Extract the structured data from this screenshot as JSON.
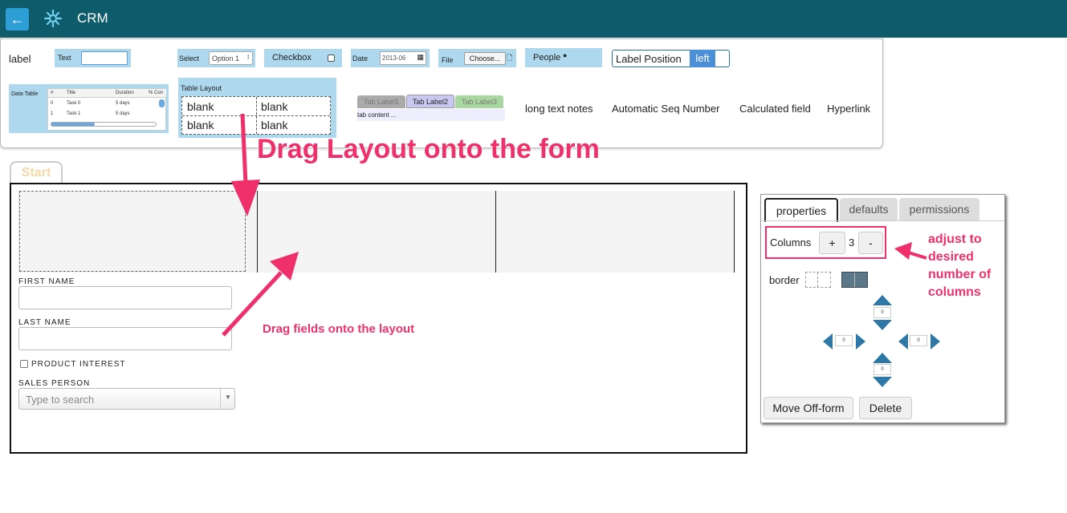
{
  "topbar": {
    "title": "CRM",
    "back_icon": "arrow-left-icon",
    "logo_icon": "asterisk-logo-icon"
  },
  "palette": {
    "label": "label",
    "text": "Text",
    "select": "Select",
    "select_value": "Option 1",
    "checkbox": "Checkbox",
    "date": "Date",
    "date_value": "2013-06",
    "file": "File",
    "file_button": "Choose...",
    "people": "People",
    "label_position": "Label Position",
    "label_position_value": "left",
    "data_table": {
      "label": "Data Table",
      "headers": [
        "#",
        "Title",
        "Duration",
        "% Con"
      ],
      "rows": [
        [
          "0",
          "Task 0",
          "5 days"
        ],
        [
          "1",
          "Task 1",
          "5 days"
        ]
      ]
    },
    "table_layout": {
      "label": "Table Layout",
      "cells": [
        "blank",
        "blank",
        "blank",
        "blank"
      ]
    },
    "tabs": {
      "labels": [
        "Tab Label1",
        "Tab Label2",
        "Tab Label3"
      ],
      "content": "tab content ..."
    },
    "long_text": "long text notes",
    "auto_seq": "Automatic Seq Number",
    "calculated": "Calculated field",
    "hyperlink": "Hyperlink"
  },
  "annotations": {
    "drag_layout": "Drag Layout onto the form",
    "drag_fields": "Drag fields onto the layout",
    "adjust_columns": [
      "adjust to",
      "desired",
      "number of",
      "columns"
    ]
  },
  "form": {
    "tab": "Start",
    "first_name": "FIRST NAME",
    "last_name": "LAST NAME",
    "product_interest": "PRODUCT INTEREST",
    "sales_person": "SALES PERSON",
    "sales_person_placeholder": "Type to search"
  },
  "properties_panel": {
    "tabs": [
      "properties",
      "defaults",
      "permissions"
    ],
    "columns_label": "Columns",
    "columns_value": "3",
    "plus": "+",
    "minus": "-",
    "border_label": "border",
    "padding": {
      "top": "0",
      "left": "0",
      "right": "0",
      "bottom": "0"
    },
    "move_off_form": "Move Off-form",
    "delete": "Delete"
  },
  "colors": {
    "topbar": "#0e5c6b",
    "accent": "#f0306a",
    "palette_item": "#add8ee"
  }
}
